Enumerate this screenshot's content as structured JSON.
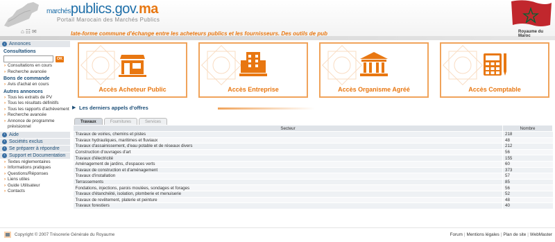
{
  "header": {
    "logo_prefix": "marchés",
    "logo_main": "publics.gov.",
    "logo_suffix": "ma",
    "logo_subtitle": "Portail Marocain des Marchés Publics",
    "tagline": "late-forme commune d'échange entre les acheteurs publics et les fournisseurs. Des outils de pub",
    "royaume": "Royaume du Maroc"
  },
  "sidebar": {
    "annonces": "Annonces",
    "consultations_title": "Consultations",
    "ok_label": "OK",
    "consultations_links": [
      "Consultations en cours",
      "Recherche avancée"
    ],
    "bons_title": "Bons de commande",
    "bons_links": [
      "Avis d'achat en cours"
    ],
    "autres_title": "Autres annonces",
    "autres_links": [
      "Tous les extraits de PV",
      "Tous les résultats définitifs",
      "Tous les rapports d'achèvement",
      "Recherche avancée",
      "Annonce de programme prévisionnel"
    ],
    "aide": "Aide",
    "societes": "Sociétés exclus",
    "preparer": "Se préparer à répondre",
    "support": "Support et Documentation",
    "support_links": [
      "Textes réglementaires",
      "Informations pratiques",
      "Questions/Réponses",
      "Liens utiles",
      "Guide Utilisateur",
      "Contacts"
    ]
  },
  "acces": [
    {
      "label": "Accès Acheteur Public",
      "icon": "shop-icon"
    },
    {
      "label": "Accès Entreprise",
      "icon": "building-icon"
    },
    {
      "label": "Accès Organisme Agréé",
      "icon": "institution-icon"
    },
    {
      "label": "Accès Comptable",
      "icon": "calculator-icon"
    }
  ],
  "offers": {
    "title": "Les derniers appels d'offres",
    "tabs": [
      "Travaux",
      "Fournitures",
      "Services"
    ],
    "col_secteur": "Secteur",
    "col_nombre": "Nombre",
    "rows": [
      {
        "secteur": "Travaux de voiries, chemins et pistes",
        "nombre": "218"
      },
      {
        "secteur": "Travaux hydrauliques, maritimes et fluviaux",
        "nombre": "48"
      },
      {
        "secteur": "Travaux d'assainissement, d'eau potable et de réseaux divers",
        "nombre": "212"
      },
      {
        "secteur": "Construction d'ouvrages d'art",
        "nombre": "56"
      },
      {
        "secteur": "Travaux d'électricité",
        "nombre": "155"
      },
      {
        "secteur": "Aménagement de jardins, d'espaces verts",
        "nombre": "60"
      },
      {
        "secteur": "Travaux de construction et d'aménagement",
        "nombre": "373"
      },
      {
        "secteur": "Travaux d'installation",
        "nombre": "57"
      },
      {
        "secteur": "Terrassements",
        "nombre": "85"
      },
      {
        "secteur": "Fondations, injections, parois moulées, sondages et forages",
        "nombre": "56"
      },
      {
        "secteur": "Travaux d'étanchéité, isolation, plomberie et menuiserie",
        "nombre": "52"
      },
      {
        "secteur": "Travaux de revêtement, platerie et peinture",
        "nombre": "48"
      },
      {
        "secteur": "Travaux forestiers",
        "nombre": "40"
      }
    ]
  },
  "footer": {
    "copyright": "Copyright © 2007 Trésorerie Générale du Royaume",
    "links": [
      "Forum",
      "Mentions légales",
      "Plan de site",
      "WebMaster"
    ]
  },
  "colors": {
    "accent": "#e87711",
    "navy": "#1d4f78",
    "blue": "#1d6ea8"
  }
}
